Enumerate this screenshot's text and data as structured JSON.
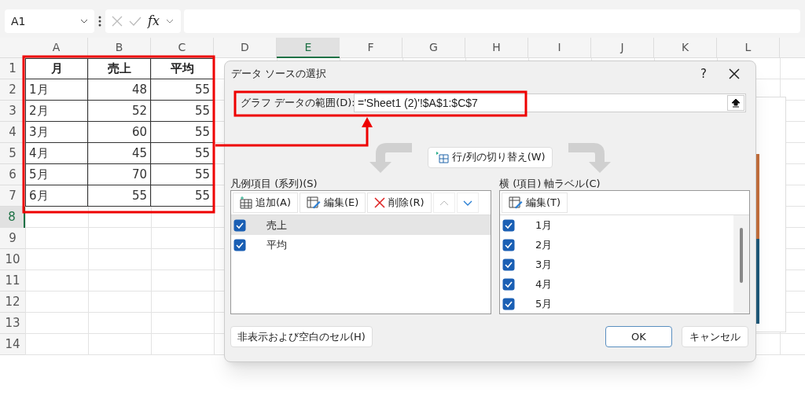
{
  "formula_bar": {
    "name_box": "A1",
    "function_label": "fx"
  },
  "sheet": {
    "columns": [
      {
        "label": "A",
        "selected": false
      },
      {
        "label": "B",
        "selected": false
      },
      {
        "label": "C",
        "selected": false
      },
      {
        "label": "D",
        "selected": false
      },
      {
        "label": "E",
        "selected": true
      },
      {
        "label": "F",
        "selected": false
      },
      {
        "label": "G",
        "selected": false
      },
      {
        "label": "H",
        "selected": false
      },
      {
        "label": "I",
        "selected": false
      },
      {
        "label": "J",
        "selected": false
      },
      {
        "label": "K",
        "selected": false
      },
      {
        "label": "L",
        "selected": false
      }
    ],
    "row_numbers": [
      {
        "label": "1",
        "selected": false
      },
      {
        "label": "2",
        "selected": false
      },
      {
        "label": "3",
        "selected": false
      },
      {
        "label": "4",
        "selected": false
      },
      {
        "label": "5",
        "selected": false
      },
      {
        "label": "6",
        "selected": false
      },
      {
        "label": "7",
        "selected": false
      },
      {
        "label": "8",
        "selected": true
      },
      {
        "label": "9",
        "selected": false
      },
      {
        "label": "10",
        "selected": false
      },
      {
        "label": "11",
        "selected": false
      },
      {
        "label": "12",
        "selected": false
      },
      {
        "label": "13",
        "selected": false
      },
      {
        "label": "14",
        "selected": false
      }
    ],
    "header": [
      "月",
      "売上",
      "平均"
    ],
    "data": [
      [
        "1月",
        "48",
        "55"
      ],
      [
        "2月",
        "52",
        "55"
      ],
      [
        "3月",
        "60",
        "55"
      ],
      [
        "4月",
        "45",
        "55"
      ],
      [
        "5月",
        "70",
        "55"
      ],
      [
        "6月",
        "55",
        "55"
      ]
    ]
  },
  "dialog": {
    "title": "データ ソースの選択",
    "help": "?",
    "range_label": "グラフ データの範囲(D):",
    "range_value": "='Sheet1 (2)'!$A$1:$C$7",
    "swap_button": "行/列の切り替え(W)",
    "legend": {
      "title": "凡例項目 (系列)(S)",
      "add_button": "追加(A)",
      "edit_button": "編集(E)",
      "delete_button": "削除(R)",
      "series": [
        {
          "label": "売上",
          "checked": true,
          "selected": true
        },
        {
          "label": "平均",
          "checked": true,
          "selected": false
        }
      ]
    },
    "axis": {
      "title": "横 (項目) 軸ラベル(C)",
      "edit_button": "編集(T)",
      "items": [
        {
          "label": "1月",
          "checked": true
        },
        {
          "label": "2月",
          "checked": true
        },
        {
          "label": "3月",
          "checked": true
        },
        {
          "label": "4月",
          "checked": true
        },
        {
          "label": "5月",
          "checked": true
        }
      ]
    },
    "hidden_cells_button": "非表示および空白のセル(H)",
    "ok_button": "OK",
    "cancel_button": "キャンセル"
  }
}
